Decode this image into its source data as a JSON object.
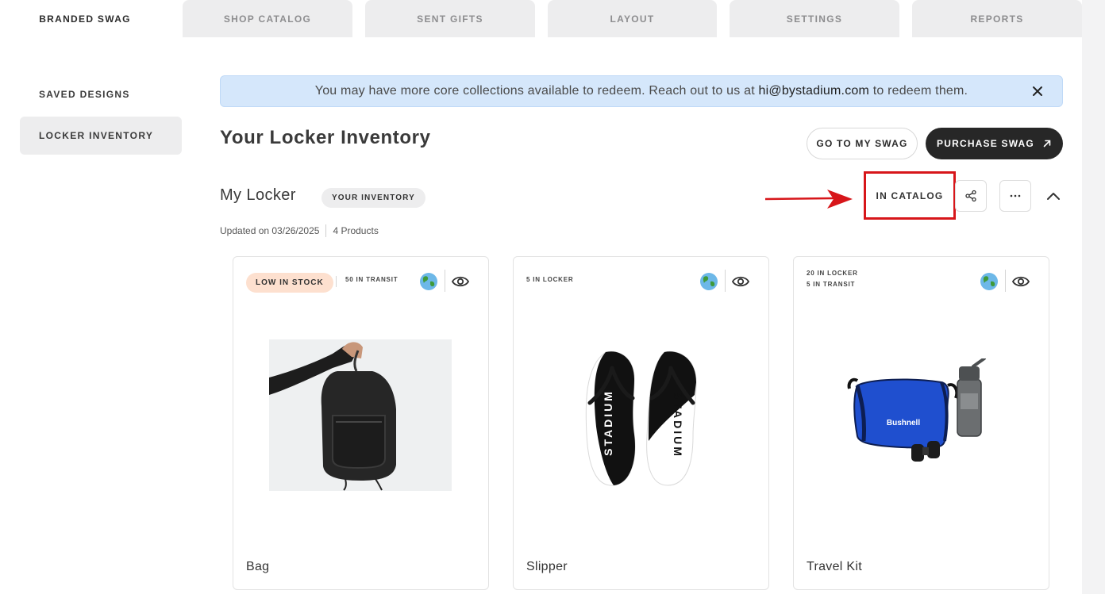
{
  "tabs": [
    "BRANDED SWAG",
    "SHOP CATALOG",
    "SENT GIFTS",
    "LAYOUT",
    "SETTINGS",
    "REPORTS"
  ],
  "sidebar": {
    "items": [
      "SAVED DESIGNS",
      "LOCKER INVENTORY"
    ],
    "active": "LOCKER INVENTORY"
  },
  "banner": {
    "text_before": "You may have more core collections available to redeem. Reach out to us at",
    "email": "hi@bystadium.com",
    "text_after": "to redeem them."
  },
  "page": {
    "title": "Your Locker Inventory",
    "go_to_swag": "GO TO MY SWAG",
    "purchase_swag": "PURCHASE SWAG"
  },
  "locker": {
    "title": "My Locker",
    "badge": "YOUR INVENTORY",
    "updated": "Updated on 03/26/2025",
    "products": "4 Products",
    "in_catalog": "IN CATALOG"
  },
  "products": [
    {
      "name": "Bag",
      "status": "LOW IN STOCK",
      "lines": [
        "50 IN TRANSIT"
      ],
      "icon": "backpack-photo"
    },
    {
      "name": "Slipper",
      "status": "",
      "lines": [
        "5 IN LOCKER"
      ],
      "icon": "flip-flops-photo",
      "brand_text": "STADIUM"
    },
    {
      "name": "Travel Kit",
      "status": "",
      "lines": [
        "20 IN LOCKER",
        "5 IN TRANSIT"
      ],
      "icon": "travel-kit-photo",
      "brand_text": "Bushnell"
    }
  ],
  "colors": {
    "dark_button": "#272727",
    "banner_bg": "#d5e7fb",
    "low_stock_bg": "#fde0cf",
    "highlight_red": "#d7161a"
  }
}
